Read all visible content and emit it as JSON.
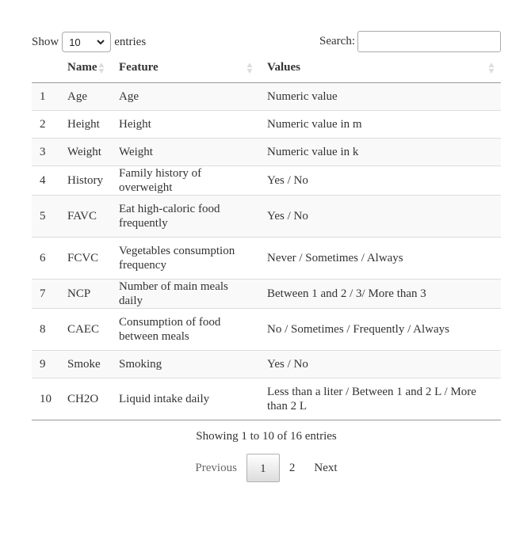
{
  "controls": {
    "show_label": "Show",
    "entries_value": "10",
    "entries_label": "entries",
    "search_label": "Search:",
    "search_value": ""
  },
  "table": {
    "headers": [
      "",
      "Name",
      "Feature",
      "Values"
    ],
    "rows": [
      [
        "1",
        "Age",
        "Age",
        "Numeric value"
      ],
      [
        "2",
        "Height",
        "Height",
        "Numeric value in m"
      ],
      [
        "3",
        "Weight",
        "Weight",
        "Numeric value in k"
      ],
      [
        "4",
        "History",
        "Family history of overweight",
        "Yes / No"
      ],
      [
        "5",
        "FAVC",
        "Eat high-caloric food frequently",
        "Yes / No"
      ],
      [
        "6",
        "FCVC",
        "Vegetables consumption frequency",
        "Never / Sometimes / Always"
      ],
      [
        "7",
        "NCP",
        "Number of main meals daily",
        "Between 1 and 2 / 3/ More than 3"
      ],
      [
        "8",
        "CAEC",
        "Consumption of food between meals",
        "No / Sometimes / Frequently / Always"
      ],
      [
        "9",
        "Smoke",
        "Smoking",
        "Yes / No"
      ],
      [
        "10",
        "CH2O",
        "Liquid intake daily",
        "Less than a liter / Between 1 and 2 L / More than 2 L"
      ]
    ]
  },
  "footer": {
    "info": "Showing 1 to 10 of 16 entries",
    "previous": "Previous",
    "pages": [
      "1",
      "2"
    ],
    "next": "Next"
  },
  "icons": {
    "sort": "sort-both-icon",
    "select": "chevron-down-icon"
  }
}
